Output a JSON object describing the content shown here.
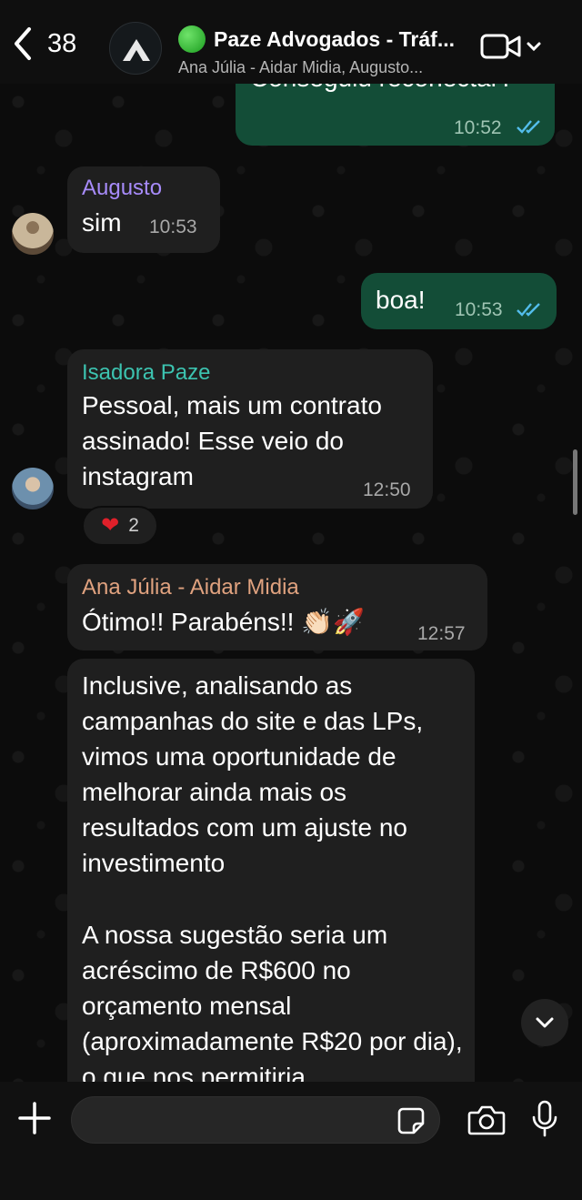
{
  "header": {
    "back_count": "38",
    "title": "Paze Advogados - Tráf...",
    "subtitle": "Ana Júlia - Aidar Midia, Augusto..."
  },
  "messages": [
    {
      "text": "Conseguiu reconectar?",
      "time": "10:52",
      "direction": "out"
    },
    {
      "sender": "Augusto",
      "text": "sim",
      "time": "10:53",
      "direction": "in",
      "sender_color": "#a78bfa"
    },
    {
      "text": "boa!",
      "time": "10:53",
      "direction": "out"
    },
    {
      "sender": "Isadora Paze",
      "text": "Pessoal, mais um contrato assinado! Esse veio do instagram",
      "time": "12:50",
      "direction": "in",
      "sender_color": "#3cc3b0"
    },
    {
      "sender": "Ana Júlia - Aidar Midia",
      "text": "Ótimo!! Parabéns!! 👏🏻🚀",
      "time": "12:57",
      "direction": "in",
      "sender_color": "#e0a27f"
    },
    {
      "text_p1": "Inclusive, analisando as campanhas do site e das LPs, vimos uma oportunidade de melhorar ainda mais os resultados com um ajuste no investimento",
      "text_p2": "A nossa sugestão seria um acréscimo de R$600 no orçamento mensal (aproximadamente R$20 por dia), o que nos permitiria",
      "direction": "in"
    }
  ],
  "reaction": {
    "emoji": "❤️",
    "count": "2"
  },
  "composer": {
    "placeholder": ""
  },
  "colors": {
    "outgoing_bubble": "#134d37",
    "incoming_bubble": "#1f1f1f",
    "read_ticks": "#53bdeb"
  },
  "icons": [
    "back-chevron-icon",
    "group-logo-icon",
    "video-call-icon",
    "chevron-down-icon",
    "read-ticks-icon",
    "heart-icon",
    "scroll-down-icon",
    "plus-icon",
    "sticker-icon",
    "camera-icon",
    "mic-icon"
  ]
}
